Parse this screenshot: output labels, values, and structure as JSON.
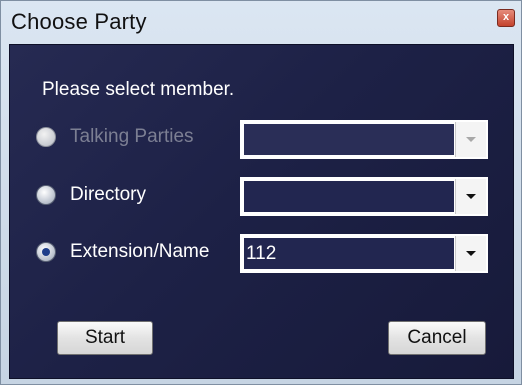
{
  "window": {
    "title": "Choose Party",
    "close_glyph": "x"
  },
  "prompt": "Please select member.",
  "options": [
    {
      "label": "Talking Parties",
      "selected": false,
      "enabled": false,
      "combo_value": ""
    },
    {
      "label": "Directory",
      "selected": false,
      "enabled": true,
      "combo_value": ""
    },
    {
      "label": "Extension/Name",
      "selected": true,
      "enabled": true,
      "combo_value": "112"
    }
  ],
  "buttons": {
    "start": "Start",
    "cancel": "Cancel"
  },
  "colors": {
    "panel_bg": "#1d2146",
    "field_bg": "#222650",
    "disabled_text": "#7c7f93"
  }
}
